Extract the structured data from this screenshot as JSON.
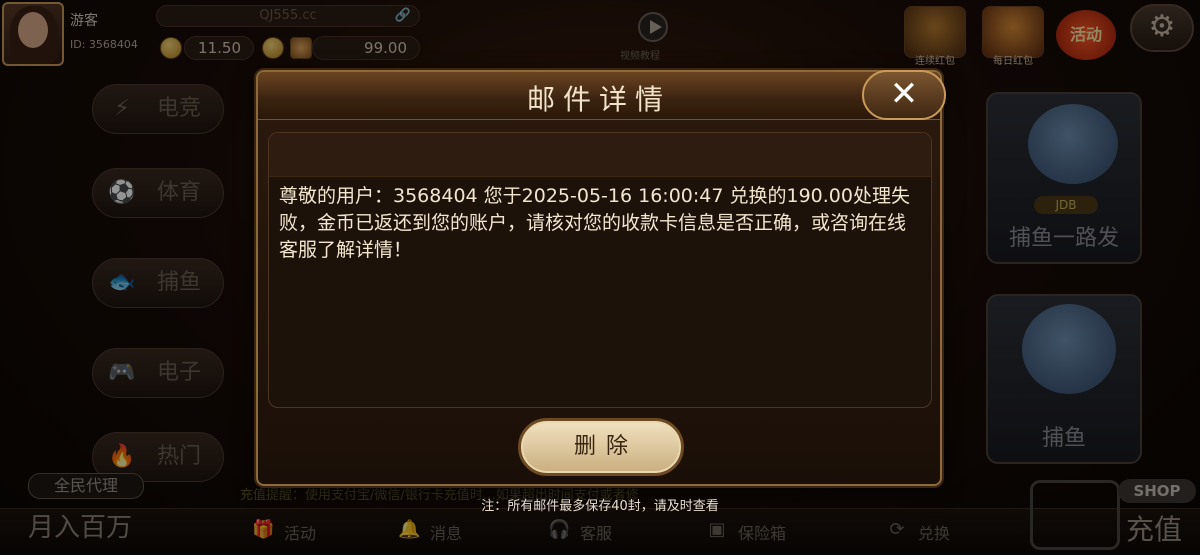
{
  "user": {
    "name": "游客",
    "id_label": "ID: 3568404"
  },
  "header": {
    "site_url": "QJ555.cc",
    "balance1": "11.50",
    "balance2": "99.00",
    "video_label": "视频教程"
  },
  "top_icons": [
    {
      "label": "连续红包"
    },
    {
      "label": "每日红包"
    }
  ],
  "activity_label": "活动",
  "left_menu": [
    {
      "label": "电竞",
      "icon": "lightning-icon"
    },
    {
      "label": "体育",
      "icon": "soccer-ball-icon"
    },
    {
      "label": "捕鱼",
      "icon": "fish-icon"
    },
    {
      "label": "电子",
      "icon": "gamepad-icon"
    },
    {
      "label": "热门",
      "icon": "flame-icon"
    }
  ],
  "right_tiles": [
    {
      "label": "捕鱼一路发",
      "badge": "JDB"
    },
    {
      "label": "捕鱼"
    }
  ],
  "marquee": "充值提醒：使用支付宝/微信/银行卡充值时…如果超出时间支付或者修",
  "bottom": {
    "agent_badge": "全民代理",
    "monthly": "月入百万",
    "items": [
      {
        "label": "活动",
        "icon": "gift-icon"
      },
      {
        "label": "消息",
        "icon": "bell-icon"
      },
      {
        "label": "客服",
        "icon": "headset-icon"
      },
      {
        "label": "保险箱",
        "icon": "safe-icon"
      },
      {
        "label": "兑换",
        "icon": "refresh-icon"
      }
    ],
    "shop": "SHOP",
    "charge": "充值"
  },
  "dialog": {
    "title": "邮件详情",
    "close": "✕",
    "message": "尊敬的用户：3568404 您于2025-05-16 16:00:47 兑换的190.00处理失败，金币已返还到您的账户，请核对您的收款卡信息是否正确，或咨询在线客服了解详情！",
    "delete": "删除"
  },
  "note": "注：所有邮件最多保存40封，请及时查看"
}
